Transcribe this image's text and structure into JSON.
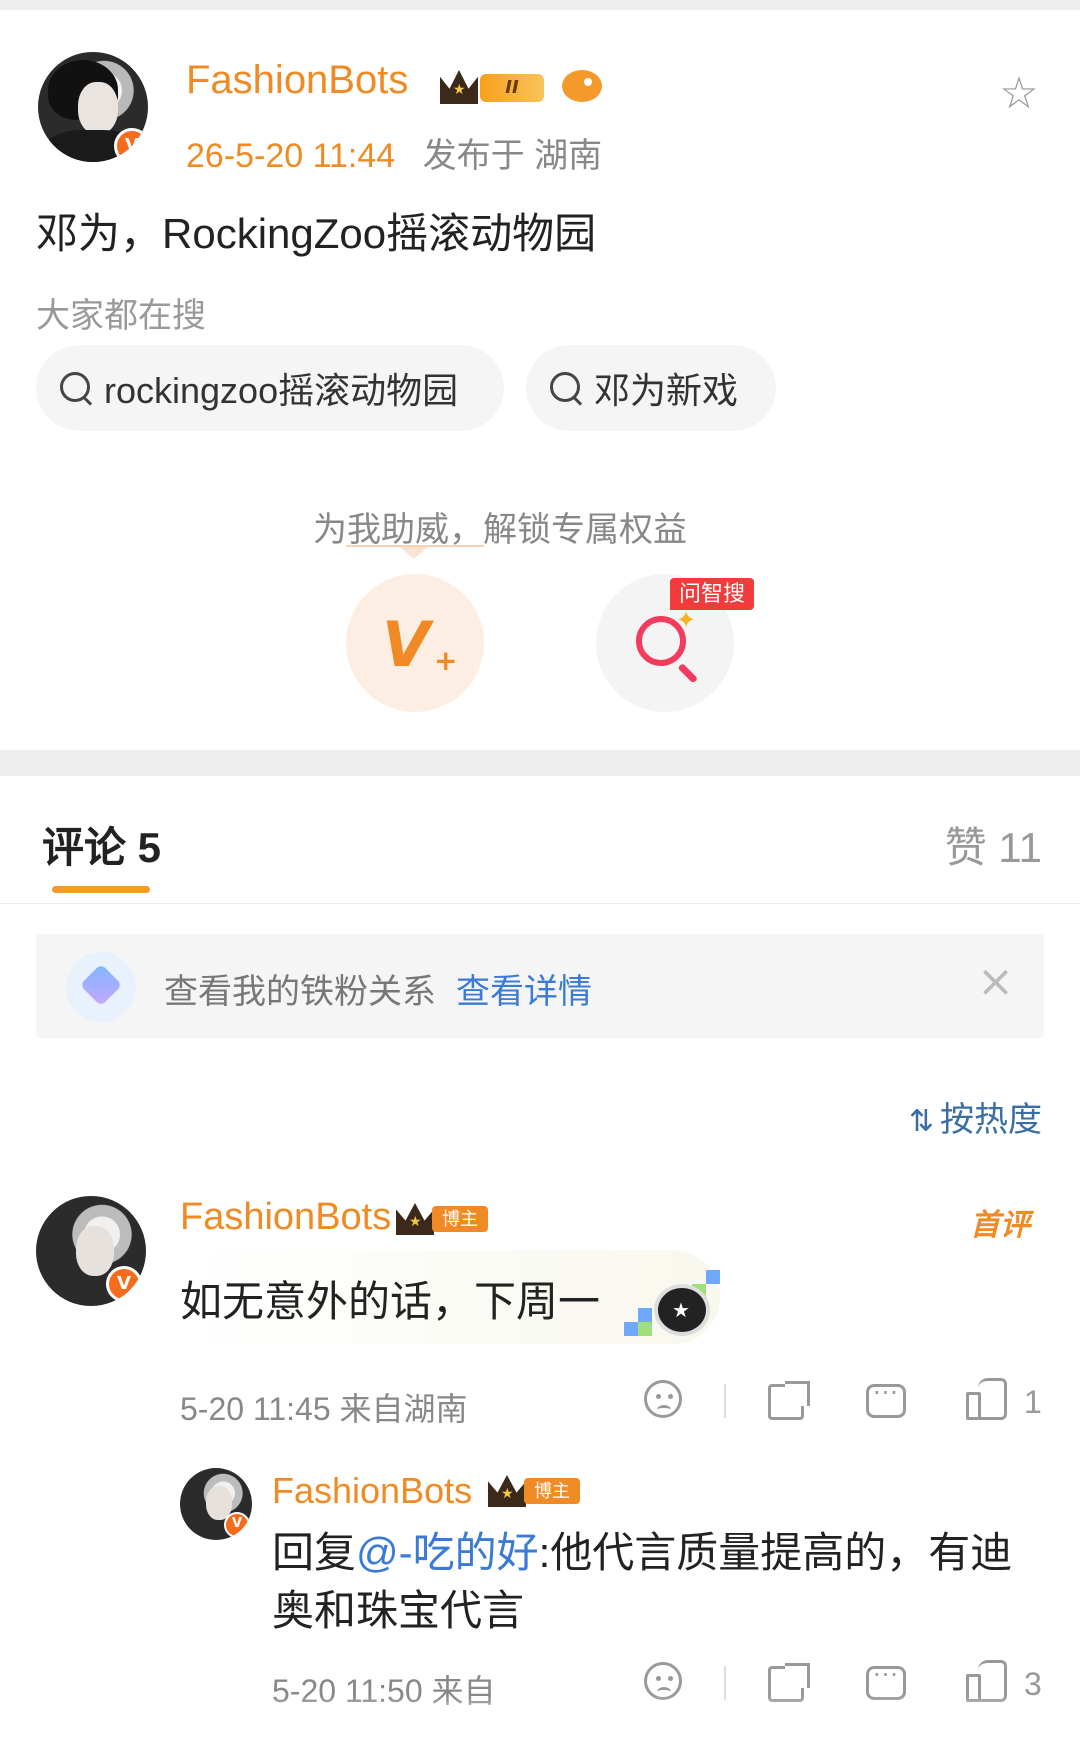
{
  "post": {
    "username": "FashionBots",
    "level_badge": "II",
    "time": "26-5-20 11:44",
    "location": "发布于 湖南",
    "text": "邓为，RockingZoo摇滚动物园",
    "search_hint": "大家都在搜",
    "search_chips": [
      "rockingzoo摇滚动物园",
      "邓为新戏"
    ],
    "support_title": "为我助威，解锁专属权益",
    "ask_tag": "问智搜",
    "icons": {
      "favorite": "star-outline-icon",
      "verified": "v-badge-icon",
      "fan": "fish-icon"
    }
  },
  "tabs": {
    "comments_label": "评论 5",
    "likes_label": "赞 11"
  },
  "fan_banner": {
    "text": "查看我的铁粉关系",
    "link": "查看详情",
    "close": "×"
  },
  "sort": {
    "label": "按热度"
  },
  "comments": [
    {
      "username": "FashionBots",
      "badge": "博主",
      "tag": "首评",
      "text": "如无意外的话，下周一",
      "time": "5-20 11:45",
      "source": "来自湖南",
      "likes": "1"
    },
    {
      "username": "FashionBots",
      "badge": "博主",
      "reply_prefix": "回复",
      "mention": "@-吃的好",
      "text": ":他代言质量提高的，有迪奥和珠宝代言",
      "time": "5-20 11:50",
      "source": "来自",
      "likes": "3"
    }
  ],
  "colors": {
    "accent_orange": "#f08a24",
    "link_blue": "#3a7bd5",
    "alert_red": "#f23b3b"
  }
}
